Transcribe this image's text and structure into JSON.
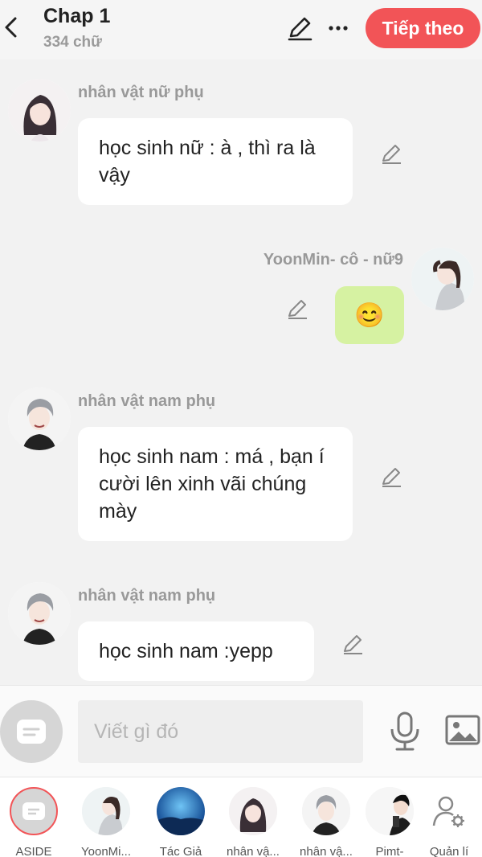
{
  "header": {
    "title": "Chap 1",
    "word_count": "334 chữ",
    "next_label": "Tiếp theo",
    "icons": [
      "back-icon",
      "pencil-icon",
      "more-icon"
    ]
  },
  "messages": [
    {
      "side": "left",
      "sender": "nhân vật nữ phụ",
      "text": "học sinh nữ : à , thì ra là vậy"
    },
    {
      "side": "right",
      "sender": "YoonMin- cô - nữ9",
      "text": "😊"
    },
    {
      "side": "left",
      "sender": "nhân vật nam phụ",
      "text": "học sinh nam : má , bạn í cười lên xinh vãi chúng mày"
    },
    {
      "side": "left",
      "sender": "nhân vật nam phụ",
      "text": "học sinh nam :yepp"
    }
  ],
  "composer": {
    "placeholder": "Viết gì đó",
    "value": "",
    "icons": [
      "aside-icon",
      "microphone-icon",
      "image-icon"
    ]
  },
  "characters": [
    {
      "label": "ASIDE"
    },
    {
      "label": "YoonMi..."
    },
    {
      "label": "Tác Giả"
    },
    {
      "label": "nhân vậ..."
    },
    {
      "label": "nhân vậ..."
    },
    {
      "label": "Pimt-"
    },
    {
      "label": "Quản lí"
    }
  ],
  "colors": {
    "accent": "#f25457",
    "my_bubble": "#d6f2a2",
    "background": "#f2f2f2"
  }
}
